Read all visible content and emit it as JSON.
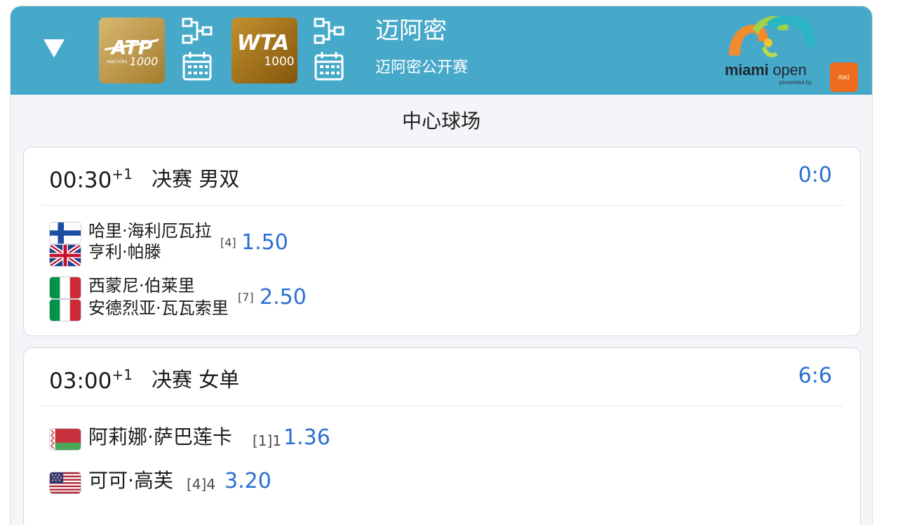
{
  "header": {
    "city": "迈阿密",
    "event": "迈阿密公开赛",
    "atp_badge": {
      "brand": "ATP",
      "sub": "MASTERS",
      "level": "1000"
    },
    "wta_badge": {
      "brand": "WTA",
      "level": "1000"
    },
    "logo": {
      "word1": "miami",
      "word2": " open",
      "presented": "presented by",
      "sponsor": "itaú"
    }
  },
  "court": {
    "title": "中心球场"
  },
  "matches": [
    {
      "time": "00:30",
      "day_offset": "+1",
      "round": "决赛 男双",
      "score": "0:0",
      "teams": [
        {
          "players": [
            "哈里·海利厄瓦拉",
            "亨利·帕滕"
          ],
          "flags": [
            "finland",
            "united-kingdom"
          ],
          "seed": "[4]",
          "odds": "1.50"
        },
        {
          "players": [
            "西蒙尼·伯莱里",
            "安德烈亚·瓦瓦索里"
          ],
          "flags": [
            "italy",
            "italy"
          ],
          "seed": "[7]",
          "odds": "2.50"
        }
      ]
    },
    {
      "time": "03:00",
      "day_offset": "+1",
      "round": "决赛 女单",
      "score": "6:6",
      "teams": [
        {
          "players": [
            "阿莉娜·萨巴莲卡"
          ],
          "flags": [
            "belarus"
          ],
          "seed": "[1]1",
          "odds": "1.36"
        },
        {
          "players": [
            "可可·高芙"
          ],
          "flags": [
            "united-states"
          ],
          "seed": "[4]4",
          "odds": "3.20"
        }
      ]
    }
  ],
  "colors": {
    "header_bg": "#47a9c9",
    "score_blue": "#2a6fd1",
    "atp_gold": "#b9923f",
    "wta_gold": "#9c6a12"
  },
  "icons": [
    "collapse-triangle-icon",
    "bracket-icon",
    "calendar-icon"
  ]
}
